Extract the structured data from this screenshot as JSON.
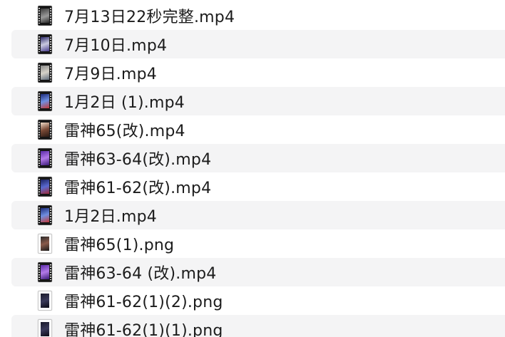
{
  "files": [
    {
      "name": "7月13日22秒完整.mp4",
      "kind": "video",
      "thumb": "linear-gradient(160deg,#3b3b3b,#9a9a9a 55%,#2a2a2a)"
    },
    {
      "name": "7月10日.mp4",
      "kind": "video",
      "thumb": "linear-gradient(160deg,#2d2a6b,#c9c9df 50%,#4b3f8f)"
    },
    {
      "name": "7月9日.mp4",
      "kind": "video",
      "thumb": "linear-gradient(160deg,#8a8a8a,#d6d2c8 50%,#5f6b7a)"
    },
    {
      "name": "1月2日 (1).mp4",
      "kind": "video",
      "thumb": "linear-gradient(160deg,#1b2a7a,#6f8fe0 50%,#c33a3a)"
    },
    {
      "name": "雷神65(改).mp4",
      "kind": "video",
      "thumb": "linear-gradient(160deg,#f0dcc8,#7a4a36 50%,#2a1a14)"
    },
    {
      "name": "雷神63-64(改).mp4",
      "kind": "video",
      "thumb": "linear-gradient(160deg,#5a2aa8,#b27ae8 50%,#3a1a78)"
    },
    {
      "name": "雷神61-62(改).mp4",
      "kind": "video",
      "thumb": "linear-gradient(160deg,#1a2060,#5a6ad0 50%,#a02a3a)"
    },
    {
      "name": "1月2日.mp4",
      "kind": "video",
      "thumb": "linear-gradient(160deg,#1b2a7a,#6f8fe0 50%,#c33a3a)"
    },
    {
      "name": "雷神65(1).png",
      "kind": "image",
      "thumb": "linear-gradient(160deg,#2a2a2a,#8a5a4a 50%,#1a1a1a)"
    },
    {
      "name": "雷神63-64 (改).mp4",
      "kind": "video",
      "thumb": "linear-gradient(160deg,#5a2aa8,#b27ae8 50%,#3a1a78)"
    },
    {
      "name": "雷神61-62(1)(2).png",
      "kind": "image",
      "thumb": "linear-gradient(160deg,#1a1a2a,#3a3a5a 50%,#0a0a14)"
    },
    {
      "name": "雷神61-62(1)(1).png",
      "kind": "image",
      "thumb": "linear-gradient(160deg,#1a1a2a,#3a3a5a 50%,#0a0a14)"
    }
  ]
}
